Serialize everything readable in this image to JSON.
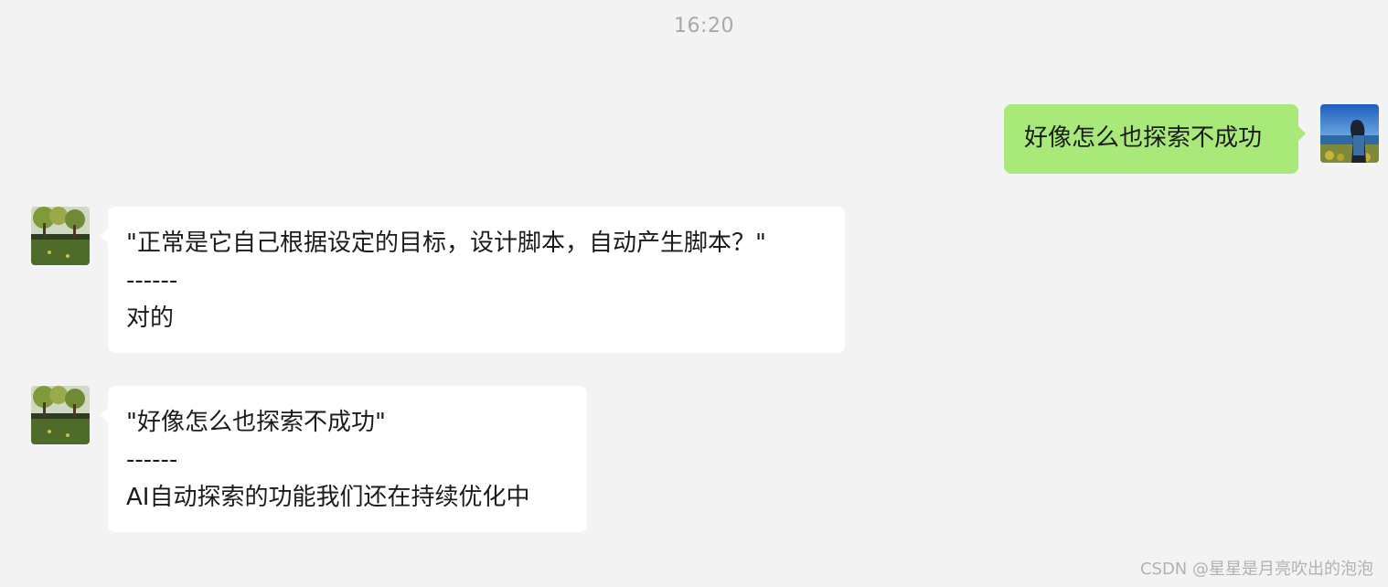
{
  "timestamp": "16:20",
  "messages": [
    {
      "direction": "outgoing",
      "lines": [
        "好像怎么也探索不成功"
      ]
    },
    {
      "direction": "incoming",
      "lines": [
        "\"正常是它自己根据设定的目标，设计脚本，自动产生脚本？\"",
        "------",
        "对的"
      ]
    },
    {
      "direction": "incoming",
      "lines": [
        "\"好像怎么也探索不成功\"",
        "------",
        "AI自动探索的功能我们还在持续优化中"
      ]
    }
  ],
  "watermark": "CSDN @星星是月亮吹出的泡泡",
  "colors": {
    "background": "#f3f3f3",
    "outgoing_bubble": "#a9e97a",
    "incoming_bubble": "#ffffff",
    "timestamp_text": "#a9a9a9"
  }
}
